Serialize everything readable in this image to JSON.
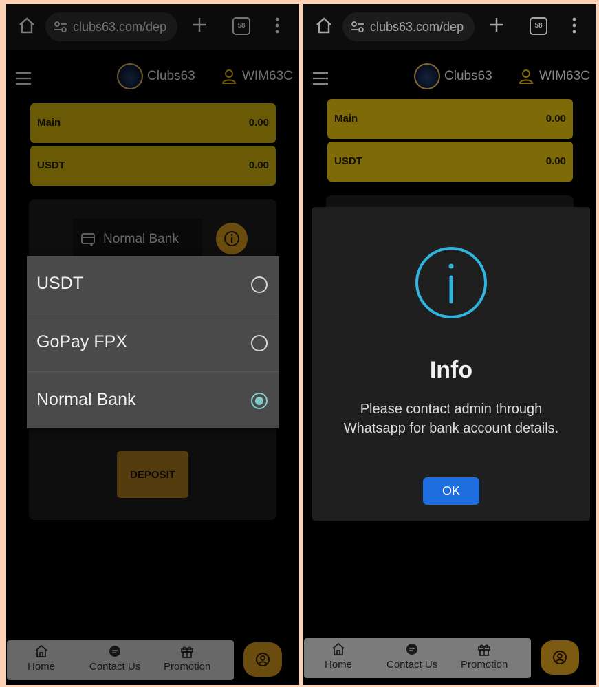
{
  "browser": {
    "url": "clubs63.com/dep",
    "tab_count": "58"
  },
  "header": {
    "brand": "Clubs63",
    "username": "WIM63C"
  },
  "balances": [
    {
      "label": "Main",
      "value": "0.00"
    },
    {
      "label": "USDT",
      "value": "0.00"
    }
  ],
  "deposit": {
    "method_label": "Normal Bank",
    "button_label": "DEPOSIT"
  },
  "dropdown": {
    "options": [
      {
        "label": "USDT",
        "selected": false
      },
      {
        "label": "GoPay FPX",
        "selected": false
      },
      {
        "label": "Normal Bank",
        "selected": true
      }
    ]
  },
  "nav": {
    "items": [
      {
        "label": "Home",
        "icon": "home-icon"
      },
      {
        "label": "Contact Us",
        "icon": "chat-icon"
      },
      {
        "label": "Promotion",
        "icon": "gift-icon"
      }
    ]
  },
  "modal": {
    "title": "Info",
    "message": "Please contact admin through Whatsapp for bank account details.",
    "ok_label": "OK"
  },
  "colors": {
    "accent_gold": "#c2a40a",
    "button_orange": "#c08a1b",
    "info_cyan": "#2fb6e0",
    "ok_blue": "#1f6ee0",
    "radio_selected": "#80cbc4",
    "background": "#fbd2b4"
  }
}
